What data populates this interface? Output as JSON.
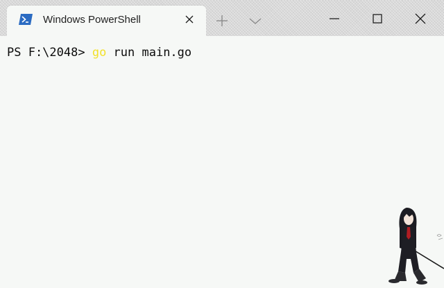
{
  "window": {
    "tab_title": "Windows PowerShell"
  },
  "icons": {
    "tab": "powershell-icon",
    "tab_close": "close-icon",
    "new_tab": "plus-icon",
    "dropdown": "chevron-down-icon",
    "minimize": "minimize-icon",
    "maximize": "maximize-icon",
    "close": "close-icon"
  },
  "terminal": {
    "prompt": "PS F:\\2048> ",
    "command": "go",
    "args": " run main.go"
  },
  "colors": {
    "titlebar_bg": "#d9d9d9",
    "terminal_bg": "#f6f8f6",
    "text": "#0c0c0c",
    "command_color": "#f2e12a",
    "icon_blue": "#2b6bc2"
  }
}
